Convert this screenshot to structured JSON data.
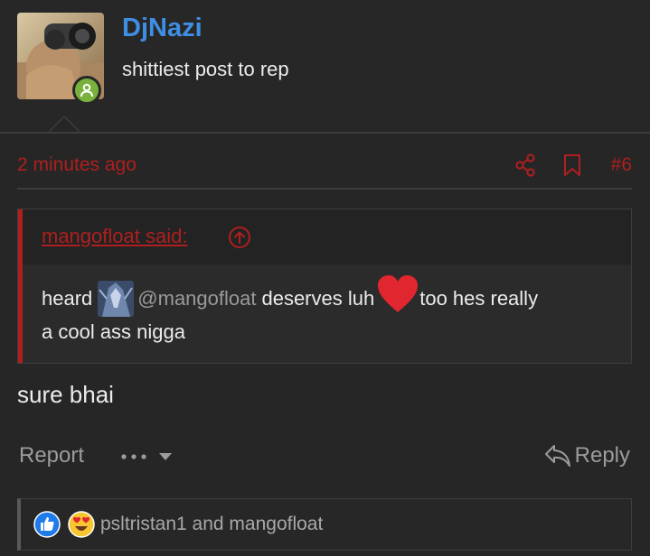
{
  "user": {
    "name": "DjNazi",
    "title": "shittiest post to rep"
  },
  "post": {
    "date": "2 minutes ago",
    "number": "#6",
    "body": "sure bhai"
  },
  "quote": {
    "author": "mangofloat said:",
    "text_before": "heard",
    "mention": "@mangofloat",
    "text_mid": "deserves luh",
    "text_after": "too hes really",
    "line2": "a cool ass nigga"
  },
  "actions": {
    "report": "Report",
    "reply": "Reply"
  },
  "reactions": {
    "names": "psltristan1 and mangofloat",
    "icons": [
      "like-icon",
      "heart-eyes-icon"
    ]
  },
  "colors": {
    "accent_red": "#b01f1f",
    "username_blue": "#3e8ee3",
    "online_green": "#78b13c",
    "background": "#262626"
  }
}
